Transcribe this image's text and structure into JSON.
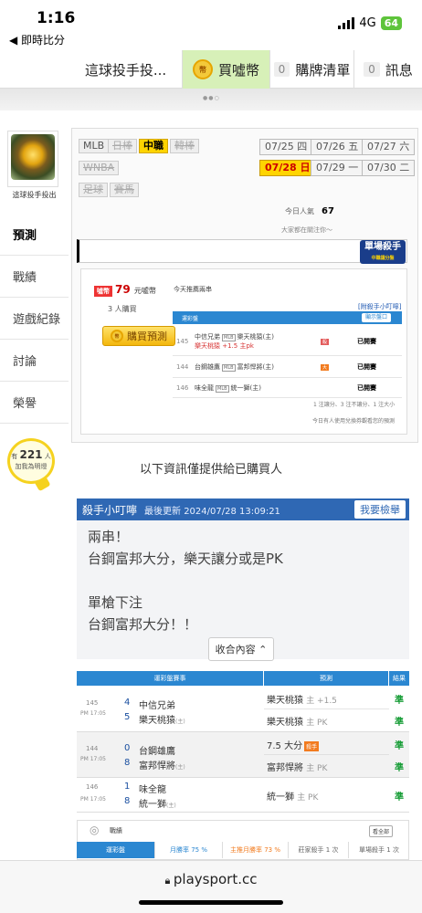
{
  "status": {
    "time": "1:16",
    "back": "◀ 即時比分",
    "network": "4G",
    "battery": "64"
  },
  "topbar": {
    "title_tab": "這球投手投...",
    "coin_icon": "幣",
    "buy_coins": "買噓幣",
    "cart_count": "0",
    "cart_label": "購牌清單",
    "msg_count": "0",
    "msg_label": "訊息"
  },
  "profile": {
    "name": "這球投手投出"
  },
  "sidebar": {
    "items": [
      "預測",
      "戰績",
      "遊戲紀錄",
      "討論",
      "榮譽"
    ],
    "bulb_prefix": "有",
    "bulb_count": "221",
    "bulb_unit": "人",
    "bulb_text": "加我為明燈"
  },
  "leagues": {
    "items": [
      "MLB",
      "日棒",
      "中職",
      "韓棒",
      "WNBA",
      "足球",
      "賽馬"
    ],
    "active": "中職"
  },
  "dates": {
    "items": [
      "07/25 四",
      "07/26 五",
      "07/27 六",
      "07/28 日",
      "07/29 一",
      "07/30 二"
    ],
    "active": "07/28 日"
  },
  "today": {
    "label": "今日人氣",
    "value": "67",
    "watching": "大家都在關注你～"
  },
  "killer": {
    "title": "單場殺手",
    "sub": "中職讓分盤"
  },
  "purchase": {
    "price_badge": "噓幣",
    "price": "79",
    "price_unit": "元噓幣",
    "buyers": "3 人購買",
    "buy_button": "購買預測",
    "recommend_label": "今天推薦兩串",
    "rules_link": "[附殺手小叮嚀]",
    "table_head": "運彩盤",
    "show_button": "顯示盤口",
    "rows": [
      {
        "no": "145",
        "away": "中信兄弟",
        "tag": "MLB",
        "home": "樂天桃猿(主)",
        "pick": "樂天桃猿 +1.5 主pk",
        "badge": "殺",
        "result": "已開賽"
      },
      {
        "no": "144",
        "away": "台鋼雄鷹",
        "tag": "MLB",
        "home": "富邦悍將(主)",
        "pick": "",
        "badge": "大",
        "result": "已開賽"
      },
      {
        "no": "146",
        "away": "味全龍",
        "tag": "MLB",
        "home": "統一獅(主)",
        "pick": "",
        "badge": "",
        "result": "已開賽"
      }
    ],
    "legend": "1 注讓分、3 注不讓分、1 注大小",
    "coupon_note": "今日有人使用兌換券觀看您的預測"
  },
  "info_line": "以下資訊僅提供給已購買人",
  "tips": {
    "title": "殺手小叮嚀",
    "updated": "最後更新 2024/07/28 13:09:21",
    "report": "我要檢舉",
    "lines": [
      "兩串！",
      "台鋼富邦大分，樂天讓分或是PK",
      "",
      "單槍下注",
      "台鋼富邦大分！！"
    ],
    "collapse": "收合內容 ⌃"
  },
  "table": {
    "head_game": "運彩盤賽事",
    "head_pred": "預測",
    "head_result": "結果",
    "games": [
      {
        "no": "145",
        "time": "PM 17:05",
        "away_score": "4",
        "away": "中信兄弟",
        "home_score": "5",
        "home": "樂天桃猿",
        "home_tag": "(主)",
        "picks": [
          {
            "team": "樂天桃猿",
            "detail": "主 +1.5",
            "badge": "",
            "result": "準"
          },
          {
            "team": "樂天桃猿",
            "detail": "主 PK",
            "badge": "",
            "result": "準"
          }
        ]
      },
      {
        "no": "144",
        "time": "PM 17:05",
        "away_score": "0",
        "away": "台鋼雄鷹",
        "home_score": "8",
        "home": "富邦悍將",
        "home_tag": "(主)",
        "picks": [
          {
            "team": "7.5 大分",
            "detail": "",
            "badge": "殺手",
            "result": "準"
          },
          {
            "team": "富邦悍將",
            "detail": "主 PK",
            "badge": "",
            "result": "準"
          }
        ]
      },
      {
        "no": "146",
        "time": "PM 17:05",
        "away_score": "1",
        "away": "味全龍",
        "home_score": "8",
        "home": "統一獅",
        "home_tag": "(主)",
        "picks": [
          {
            "team": "統一獅",
            "detail": "主 PK",
            "badge": "",
            "result": "準"
          }
        ]
      }
    ]
  },
  "stats": {
    "label": "戰績",
    "view_all": "看全部",
    "tabs": [
      "運彩盤",
      "月勝率 75 %",
      "主推月勝率 73 %",
      "莊家殺手 1 次",
      "單場殺手 1 次"
    ]
  },
  "browser": {
    "url": "playsport.cc"
  },
  "colors": {
    "accent_blue": "#2b87d1",
    "header_blue": "#2f68b4",
    "active_yellow": "#ffd400",
    "correct_green": "#1a9e39"
  }
}
